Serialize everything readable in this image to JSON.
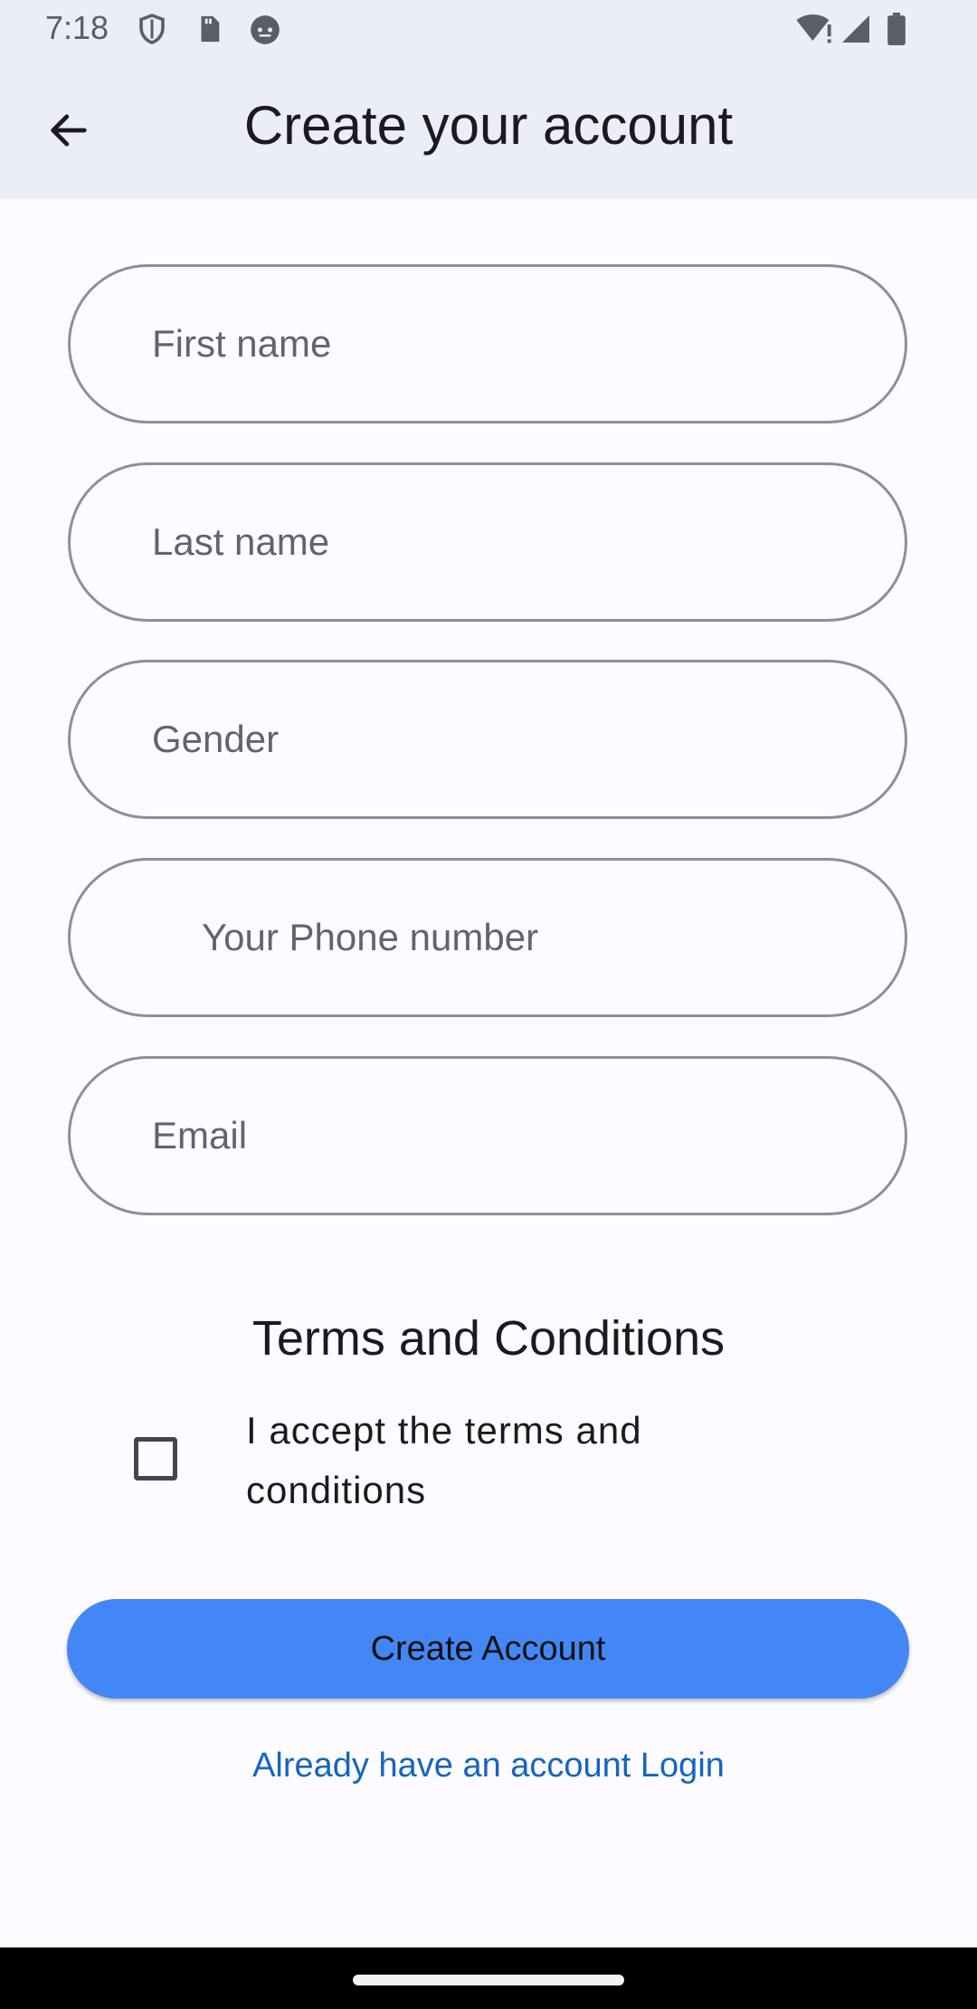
{
  "status_bar": {
    "time": "7:18",
    "icons": [
      "shield-icon",
      "sd-card-icon",
      "android-robot-icon",
      "wifi-alert-icon",
      "cell-signal-icon",
      "battery-icon"
    ]
  },
  "app_bar": {
    "back_icon": "arrow-back-icon",
    "title": "Create your account"
  },
  "form": {
    "first_name_placeholder": "First name",
    "last_name_placeholder": "Last name",
    "gender_placeholder": "Gender",
    "phone_placeholder": "Your Phone number",
    "email_placeholder": "Email"
  },
  "terms": {
    "title": "Terms and Conditions",
    "accept_label": "I accept the terms and conditions",
    "checked": false
  },
  "actions": {
    "create_label": "Create Account",
    "login_link": "Already have an account Login"
  },
  "colors": {
    "app_bar_bg": "#ebeef9",
    "primary_button": "#4287f5",
    "link": "#1565c0",
    "field_border": "#8e8f98"
  }
}
